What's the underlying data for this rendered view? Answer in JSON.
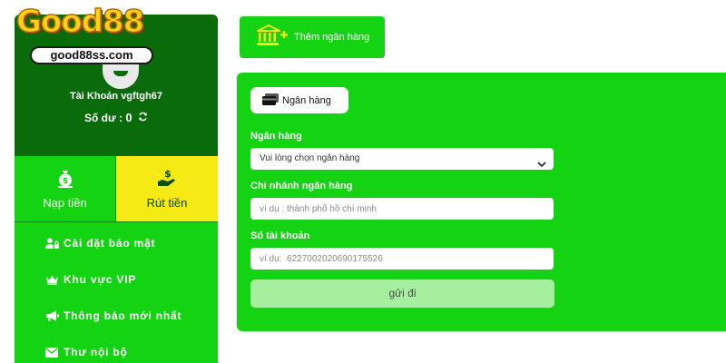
{
  "logo": {
    "brand": "Good88",
    "domain": "good88ss.com"
  },
  "profile": {
    "account_label": "Tài Khoản vgftgh67",
    "balance_label": "Số dư :",
    "balance_value": "0"
  },
  "wallet": {
    "deposit_label": "Nạp tiền",
    "withdraw_label": "Rút tiền"
  },
  "menu": {
    "items": [
      {
        "label": "Cài đặt bảo mật",
        "icon": "user-lock-icon"
      },
      {
        "label": "Khu vực VIP",
        "icon": "crown-icon"
      },
      {
        "label": "Thông báo mới nhất",
        "icon": "megaphone-icon"
      },
      {
        "label": "Thư nội bộ",
        "icon": "envelope-icon"
      }
    ]
  },
  "add_bank": {
    "label": "Thêm ngân hàng",
    "icon": "bank-plus-icon"
  },
  "form": {
    "tab_label": "Ngân hàng",
    "bank_label": "Ngân hàng",
    "bank_select_value": "Vui lòng chọn ngân hàng",
    "branch_label": "Chi nhánh ngân hàng",
    "branch_placeholder": "ví dụ : thành phố hồ chí minh",
    "account_label": "Số tài khoản",
    "account_placeholder": "ví dụ:  6227002020690175526",
    "submit_label": "gửi đi"
  },
  "colors": {
    "primary_green": "#13d313",
    "dark_green": "#0a6b0a",
    "accent_yellow": "#f5ea14",
    "submit_disabled": "#a6ef9e"
  }
}
